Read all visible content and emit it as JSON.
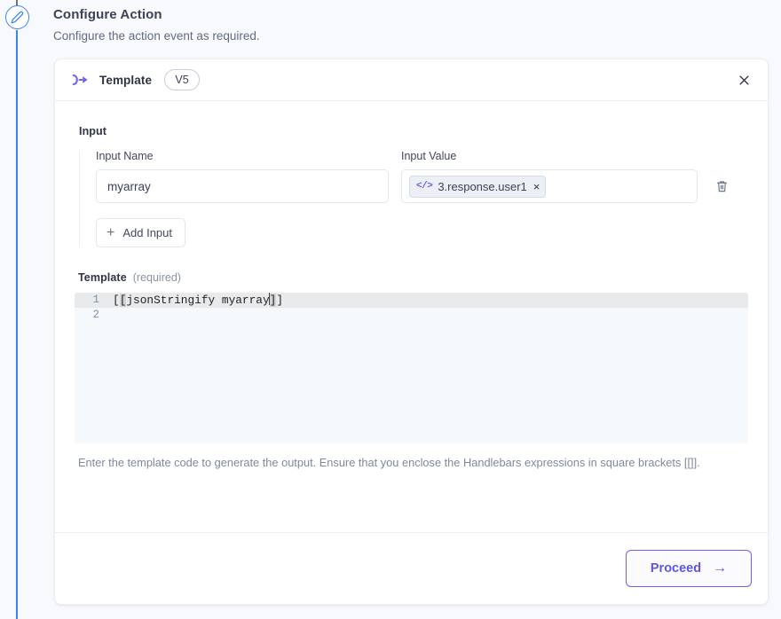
{
  "page": {
    "title": "Configure Action",
    "subtitle": "Configure the action event as required.",
    "step_icon": "pencil-icon",
    "accent_rail_color": "#3b82f6",
    "background_color": "#f7f9fc"
  },
  "card": {
    "icon": "template-node-icon",
    "title": "Template",
    "version_badge": "V5",
    "close_icon": "close-icon"
  },
  "input_section": {
    "heading": "Input",
    "name_label": "Input Name",
    "name_value": "myarray",
    "name_placeholder": "Input Name",
    "value_label": "Input Value",
    "value_chip": {
      "icon": "code-icon",
      "icon_glyph": "</>",
      "text": "3.response.user1",
      "remove_glyph": "×",
      "background_color": "#eceff5",
      "border_color": "#d3dced",
      "icon_color": "#6366f1"
    },
    "delete_icon": "trash-icon",
    "add_input_label": "Add Input",
    "add_input_glyph": "+"
  },
  "template_section": {
    "heading": "Template",
    "required_note": "(required)",
    "editor": {
      "lines": [
        {
          "number": "1",
          "text": "[[jsonStringify myarray]]",
          "active": true
        },
        {
          "number": "2",
          "text": "",
          "active": false
        }
      ],
      "code_line1_prefix": "[",
      "code_line1_open_bracket": "[",
      "code_line1_body": "jsonStringify myarray",
      "code_line1_close_bracket": "]",
      "code_line1_suffix": "]",
      "background_color": "#f6f9fc",
      "active_line_color": "#e8eaec",
      "gutter_color": "#7d93ad"
    },
    "help_text": "Enter the template code to generate the output. Ensure that you enclose the Handlebars expressions in square brackets [[]]."
  },
  "footer": {
    "proceed_label": "Proceed",
    "proceed_arrow": "→",
    "proceed_color": "#5b55e8"
  }
}
